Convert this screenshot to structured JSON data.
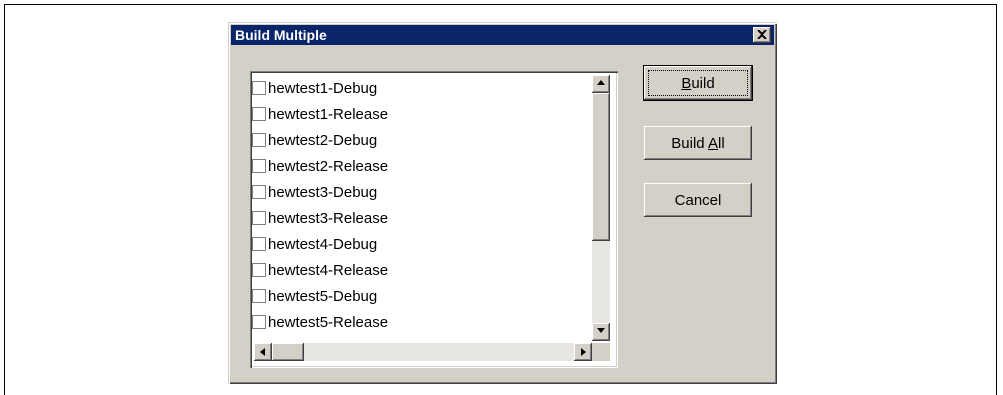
{
  "dialog": {
    "title": "Build Multiple",
    "items": [
      {
        "label": "hewtest1-Debug",
        "checked": false
      },
      {
        "label": "hewtest1-Release",
        "checked": false
      },
      {
        "label": "hewtest2-Debug",
        "checked": false
      },
      {
        "label": "hewtest2-Release",
        "checked": false
      },
      {
        "label": "hewtest3-Debug",
        "checked": false
      },
      {
        "label": "hewtest3-Release",
        "checked": false
      },
      {
        "label": "hewtest4-Debug",
        "checked": false
      },
      {
        "label": "hewtest4-Release",
        "checked": false
      },
      {
        "label": "hewtest5-Debug",
        "checked": false
      },
      {
        "label": "hewtest5-Release",
        "checked": false
      }
    ],
    "buttons": {
      "build": {
        "prefix": "",
        "accel": "B",
        "suffix": "uild"
      },
      "build_all": {
        "prefix": "Build ",
        "accel": "A",
        "suffix": "ll"
      },
      "cancel": "Cancel"
    }
  },
  "icons": [
    "close-icon",
    "arrow-up-icon",
    "arrow-down-icon",
    "arrow-left-icon",
    "arrow-right-icon"
  ],
  "colors": {
    "titlebar": "#0a246a",
    "dialog_face": "#d4d0c8"
  }
}
